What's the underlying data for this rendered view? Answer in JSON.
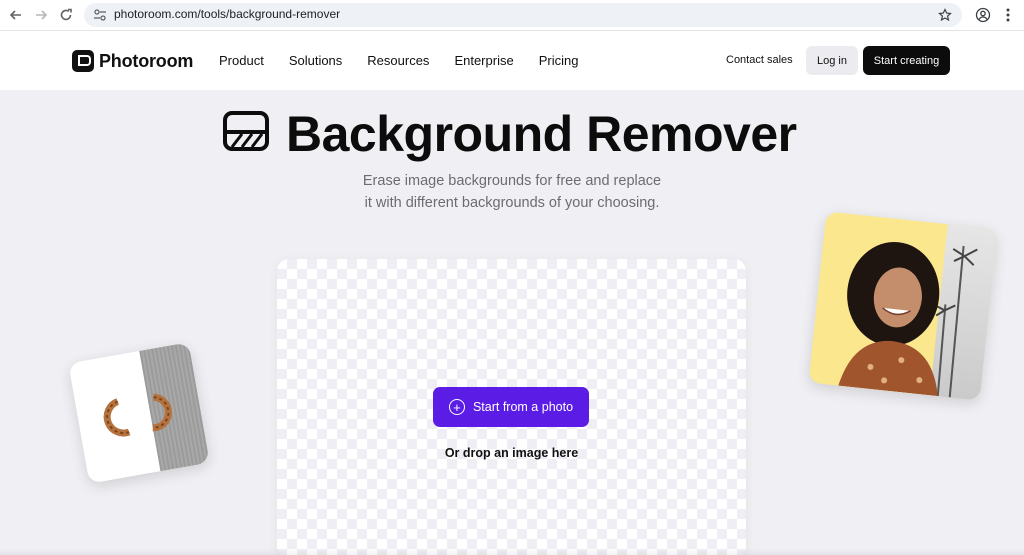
{
  "browser": {
    "url": "photoroom.com/tools/background-remover"
  },
  "nav": {
    "brand": "Photoroom",
    "links": [
      "Product",
      "Solutions",
      "Resources",
      "Enterprise",
      "Pricing"
    ],
    "contact_sales": "Contact sales",
    "login": "Log in",
    "start_creating": "Start creating"
  },
  "hero": {
    "title": "Background Remover",
    "subtitle_line1": "Erase image backgrounds for free and replace",
    "subtitle_line2": "it with different backgrounds of your choosing."
  },
  "upload": {
    "button_label": "Start from a photo",
    "drop_text": "Or drop an image here"
  },
  "colors": {
    "accent": "#5b1de6",
    "page_bg": "#f0f0f4",
    "dark_button": "#0c0c0c"
  },
  "icons": [
    "back-arrow-icon",
    "forward-arrow-icon",
    "reload-icon",
    "site-settings-icon",
    "bookmark-star-icon",
    "profile-icon",
    "menu-dots-icon",
    "background-remover-icon",
    "plus-circle-icon"
  ]
}
